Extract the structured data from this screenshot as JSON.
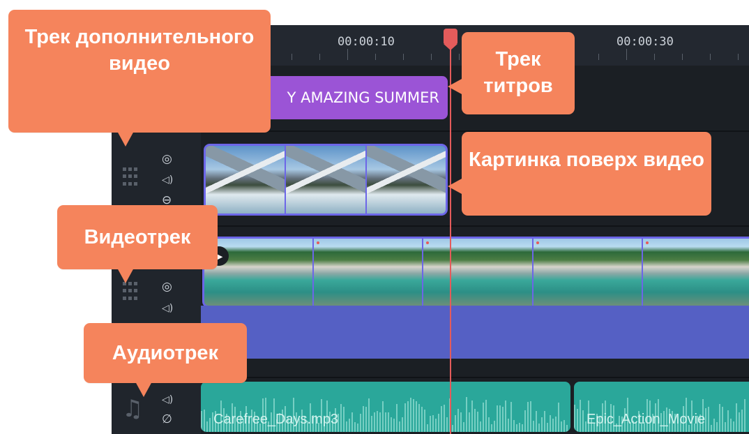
{
  "ruler": {
    "marks": [
      "00:00:10",
      "00:00:30"
    ]
  },
  "title_clip": {
    "label": "Y AMAZING SUMMER"
  },
  "audio_clips": [
    {
      "label": "Carefree_Days.mp3"
    },
    {
      "label": "Epic_Action_Movie"
    }
  ],
  "callouts": {
    "overlay_track": "Трек дополнительного видео",
    "title_track": "Трек титров",
    "picture_overlay": "Картинка поверх видео",
    "video_track": "Видеотрек",
    "audio_track": "Аудиотрек"
  },
  "icons": {
    "eye": "◎",
    "speaker": "◁)",
    "link": "⊖",
    "mute": "∅",
    "music_note": "♫",
    "play": "▶"
  },
  "colors": {
    "callout": "#f5845c",
    "title_clip": "#9b54d6",
    "clip_border": "#6c66e8",
    "audio_lane": "#5560c4",
    "audio_clip": "#2aa79a",
    "playhead": "#e45b5b"
  }
}
